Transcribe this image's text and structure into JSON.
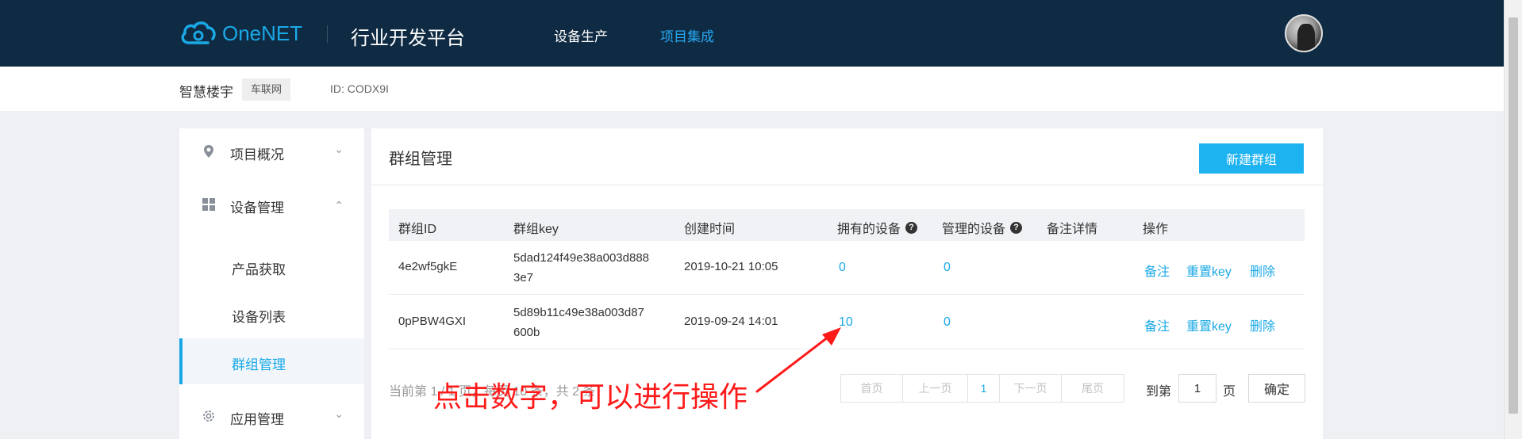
{
  "topbar": {
    "logo_text": "OneNET",
    "platform_title": "行业开发平台",
    "nav": [
      {
        "label": "设备生产",
        "active": false
      },
      {
        "label": "项目集成",
        "active": true
      }
    ],
    "accent_color": "#27a8f0"
  },
  "subbar": {
    "project_name": "智慧楼宇",
    "project_tag": "车联网",
    "project_id": "ID: CODX9I"
  },
  "sidebar": {
    "items": [
      {
        "label": "项目概况",
        "icon": "location-pin-icon",
        "chevron": "chevron-down-icon"
      },
      {
        "label": "设备管理",
        "icon": "grid-icon",
        "chevron": "chevron-up-icon"
      },
      {
        "label": "应用管理",
        "icon": "gear-icon",
        "chevron": "chevron-down-icon"
      }
    ],
    "subitems": [
      {
        "label": "产品获取",
        "active": false
      },
      {
        "label": "设备列表",
        "active": false
      },
      {
        "label": "群组管理",
        "active": true
      }
    ]
  },
  "main": {
    "title": "群组管理",
    "new_button": "新建群组",
    "columns": [
      "群组ID",
      "群组key",
      "创建时间",
      "拥有的设备",
      "管理的设备",
      "备注详情",
      "操作"
    ],
    "rows": [
      {
        "group_id": "4e2wf5gkE",
        "group_key_line1": "5dad124f49e38a003d888",
        "group_key_line2": "3e7",
        "created": "2019-10-21 10:05",
        "owned_devices": "0",
        "managed_devices": "0",
        "remark": "",
        "actions": [
          "备注",
          "重置key",
          "删除"
        ]
      },
      {
        "group_id": "0pPBW4GXI",
        "group_key_line1": "5d89b11c49e38a003d87",
        "group_key_line2": "600b",
        "created": "2019-09-24 14:01",
        "owned_devices": "10",
        "managed_devices": "0",
        "remark": "",
        "actions": [
          "备注",
          "重置key",
          "删除"
        ]
      }
    ],
    "pager": {
      "info": "当前第 1 / 1 页，每页 10 条，共 2 条",
      "first": "首页",
      "prev": "上一页",
      "current": "1",
      "next": "下一页",
      "last": "尾页",
      "goto_label": "到第",
      "goto_value": "1",
      "page_suffix": "页",
      "confirm": "确定"
    }
  },
  "annotation": {
    "text": "点击数字，可以进行操作",
    "color": "#ff1a1a"
  }
}
